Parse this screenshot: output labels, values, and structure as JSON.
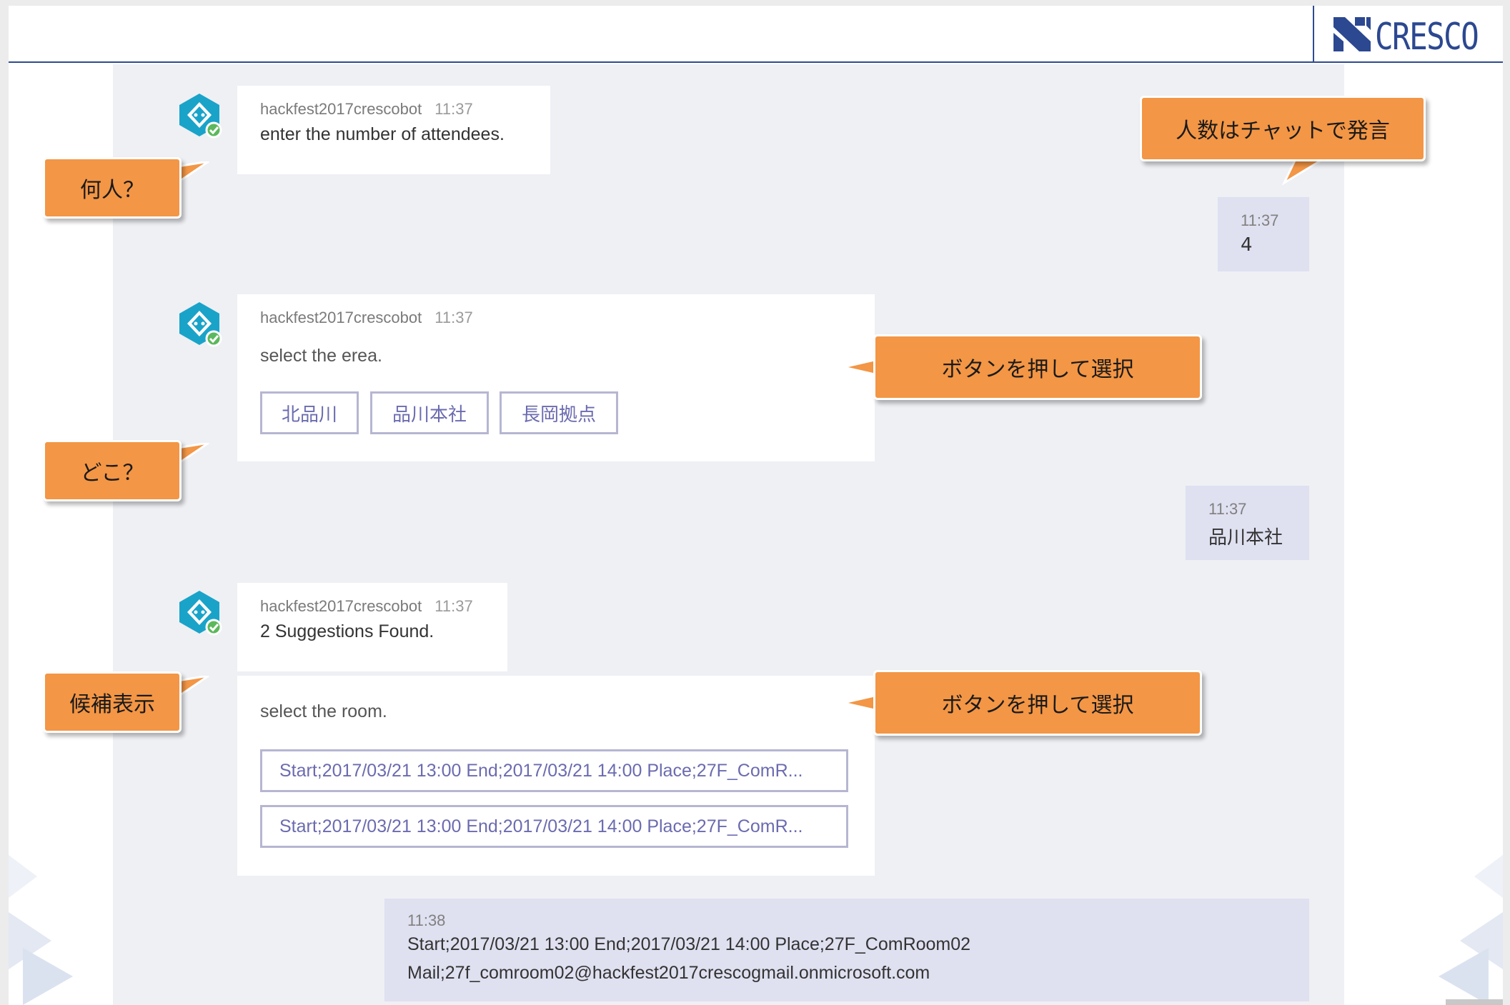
{
  "brand": {
    "logo_text": "CRESCO",
    "logo_color": "#2c4891"
  },
  "colors": {
    "callout": "#f39645",
    "chat_bg": "#eef0f4",
    "user_bubble": "#dfe0f0",
    "button_border": "#b6b6d2",
    "button_text": "#6b6bb0"
  },
  "bot": {
    "avatar_icon": "bot-avatar-icon",
    "status_icon": "online-check-icon"
  },
  "messages": [
    {
      "sender": "hackfest2017crescobot",
      "time": "11:37",
      "text": "enter the number of attendees."
    },
    {
      "sender": "hackfest2017crescobot",
      "time": "11:37",
      "text": "select the erea.",
      "buttons": [
        "北品川",
        "品川本社",
        "長岡拠点"
      ]
    },
    {
      "sender": "hackfest2017crescobot",
      "time": "11:37",
      "text": "2 Suggestions Found."
    }
  ],
  "room_card": {
    "text": "select the room.",
    "options": [
      "Start;2017/03/21 13:00 End;2017/03/21 14:00 Place;27F_ComR...",
      "Start;2017/03/21 13:00 End;2017/03/21 14:00 Place;27F_ComR..."
    ]
  },
  "user_messages": [
    {
      "time": "11:37",
      "text": "4"
    },
    {
      "time": "11:37",
      "text": "品川本社"
    },
    {
      "time": "11:38",
      "line1": "Start;2017/03/21 13:00 End;2017/03/21 14:00 Place;27F_ComRoom02",
      "line2": "Mail;27f_comroom02@hackfest2017crescogmail.onmicrosoft.com"
    }
  ],
  "callouts": {
    "how_many": "何人？",
    "speak_in_chat": "人数はチャットで発言",
    "where": "どこ？",
    "press_button_1": "ボタンを押して選択",
    "show_candidates": "候補表示",
    "press_button_2": "ボタンを押して選択"
  }
}
